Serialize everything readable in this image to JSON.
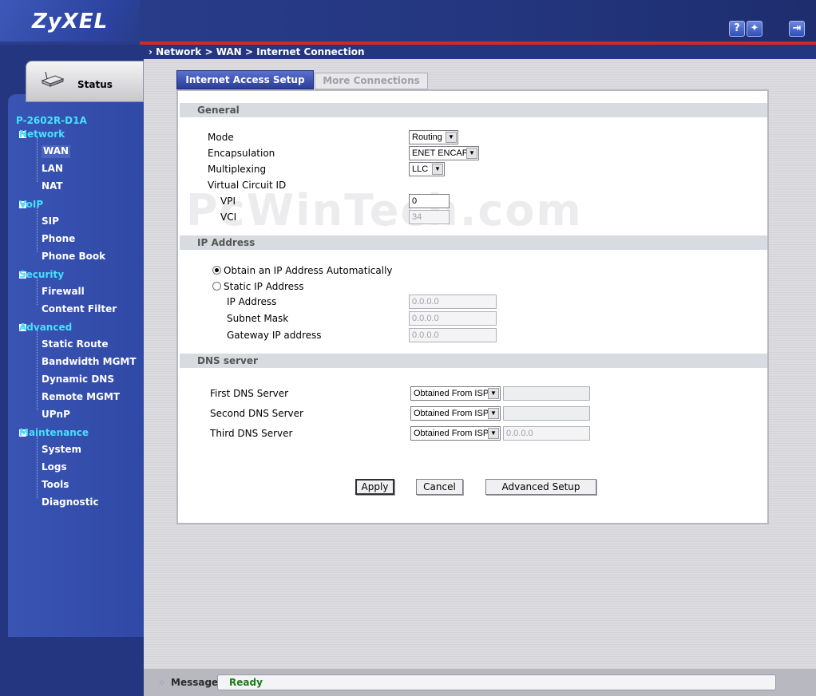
{
  "header": {
    "logo": "ZyXEL",
    "help_glyph": "?",
    "wizard_glyph": "✦",
    "logout_glyph": "⇥"
  },
  "sidebar": {
    "status_label": "Status",
    "device_name": "P-2602R-D1A",
    "groups": [
      {
        "label": "Network",
        "items": [
          "WAN",
          "LAN",
          "NAT"
        ]
      },
      {
        "label": "VoIP",
        "items": [
          "SIP",
          "Phone",
          "Phone Book"
        ]
      },
      {
        "label": "Security",
        "items": [
          "Firewall",
          "Content Filter"
        ]
      },
      {
        "label": "Advanced",
        "items": [
          "Static Route",
          "Bandwidth MGMT",
          "Dynamic DNS",
          "Remote MGMT",
          "UPnP"
        ]
      },
      {
        "label": "Maintenance",
        "items": [
          "System",
          "Logs",
          "Tools",
          "Diagnostic"
        ]
      }
    ]
  },
  "breadcrumb": "Network > WAN > Internet Connection",
  "tabs": [
    "Internet Access Setup",
    "More Connections"
  ],
  "watermark": "PcWinTech.com",
  "general": {
    "title": "General",
    "mode_label": "Mode",
    "mode_value": "Routing",
    "encapsulation_label": "Encapsulation",
    "encapsulation_value": "ENET ENCAP",
    "multiplexing_label": "Multiplexing",
    "multiplexing_value": "LLC",
    "vcid_label": "Virtual Circuit ID",
    "vpi_label": "VPI",
    "vpi_value": "0",
    "vci_label": "VCI",
    "vci_value": "34"
  },
  "ip": {
    "title": "IP Address",
    "auto_label": "Obtain an IP Address Automatically",
    "static_label": "Static IP Address",
    "ip_label": "IP Address",
    "ip_value": "0.0.0.0",
    "mask_label": "Subnet Mask",
    "mask_value": "0.0.0.0",
    "gateway_label": "Gateway IP address",
    "gateway_value": "0.0.0.0"
  },
  "dns": {
    "title": "DNS server",
    "first_label": "First DNS Server",
    "first_value": "Obtained From ISP",
    "second_label": "Second DNS Server",
    "second_value": "Obtained From ISP",
    "third_label": "Third DNS Server",
    "third_value": "Obtained From ISP",
    "third_ip": "0.0.0.0"
  },
  "buttons": {
    "apply": "Apply",
    "cancel": "Cancel",
    "advanced": "Advanced Setup"
  },
  "message": {
    "label": "Message",
    "value": "Ready"
  }
}
